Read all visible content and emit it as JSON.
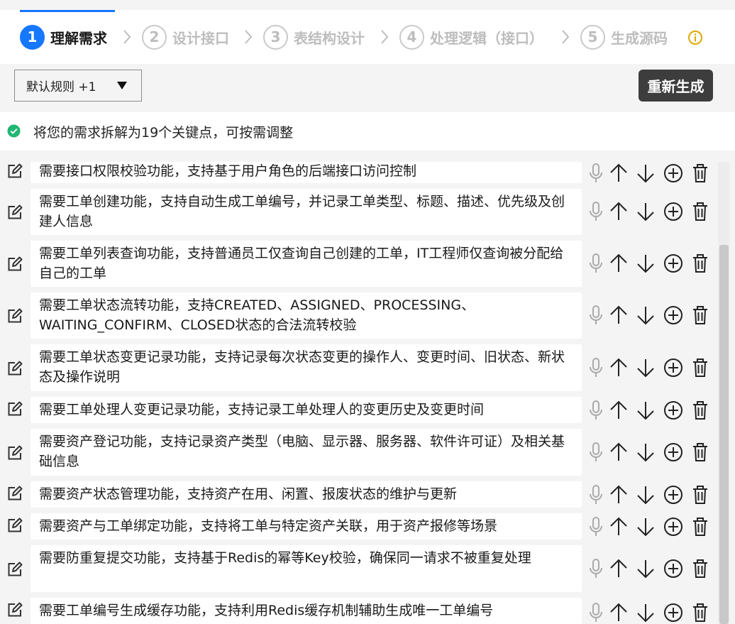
{
  "steps": [
    {
      "number": "1",
      "label": "理解需求",
      "active": true
    },
    {
      "number": "2",
      "label": "设计接口",
      "active": false
    },
    {
      "number": "3",
      "label": "表结构设计",
      "active": false
    },
    {
      "number": "4",
      "label": "处理逻辑（接口）",
      "active": false
    },
    {
      "number": "5",
      "label": "生成源码",
      "active": false
    }
  ],
  "toolbar": {
    "rules_select_value": "默认规则 +1",
    "regenerate_label": "重新生成"
  },
  "notice": {
    "text": "将您的需求拆解为19个关键点，可按需调整"
  },
  "requirements": [
    "需要接口权限校验功能，支持基于用户角色的后端接口访问控制",
    "需要工单创建功能，支持自动生成工单编号，并记录工单类型、标题、描述、优先级及创建人信息",
    "需要工单列表查询功能，支持普通员工仅查询自己创建的工单，IT工程师仅查询被分配给自己的工单",
    "需要工单状态流转功能，支持CREATED、ASSIGNED、PROCESSING、WAITING_CONFIRM、CLOSED状态的合法流转校验",
    "需要工单状态变更记录功能，支持记录每次状态变更的操作人、变更时间、旧状态、新状态及操作说明",
    "需要工单处理人变更记录功能，支持记录工单处理人的变更历史及变更时间",
    "需要资产登记功能，支持记录资产类型（电脑、显示器、服务器、软件许可证）及相关基础信息",
    "需要资产状态管理功能，支持资产在用、闲置、报废状态的维护与更新",
    "需要资产与工单绑定功能，支持将工单与特定资产关联，用于资产报修等场景",
    "需要防重复提交功能，支持基于Redis的幂等Key校验，确保同一请求不被重复处理",
    "需要工单编号生成缓存功能，支持利用Redis缓存机制辅助生成唯一工单编号"
  ],
  "colors": {
    "accent": "#1677ff",
    "success": "#22b573",
    "info": "#e0a800",
    "button_dark": "#3d3d3d"
  }
}
